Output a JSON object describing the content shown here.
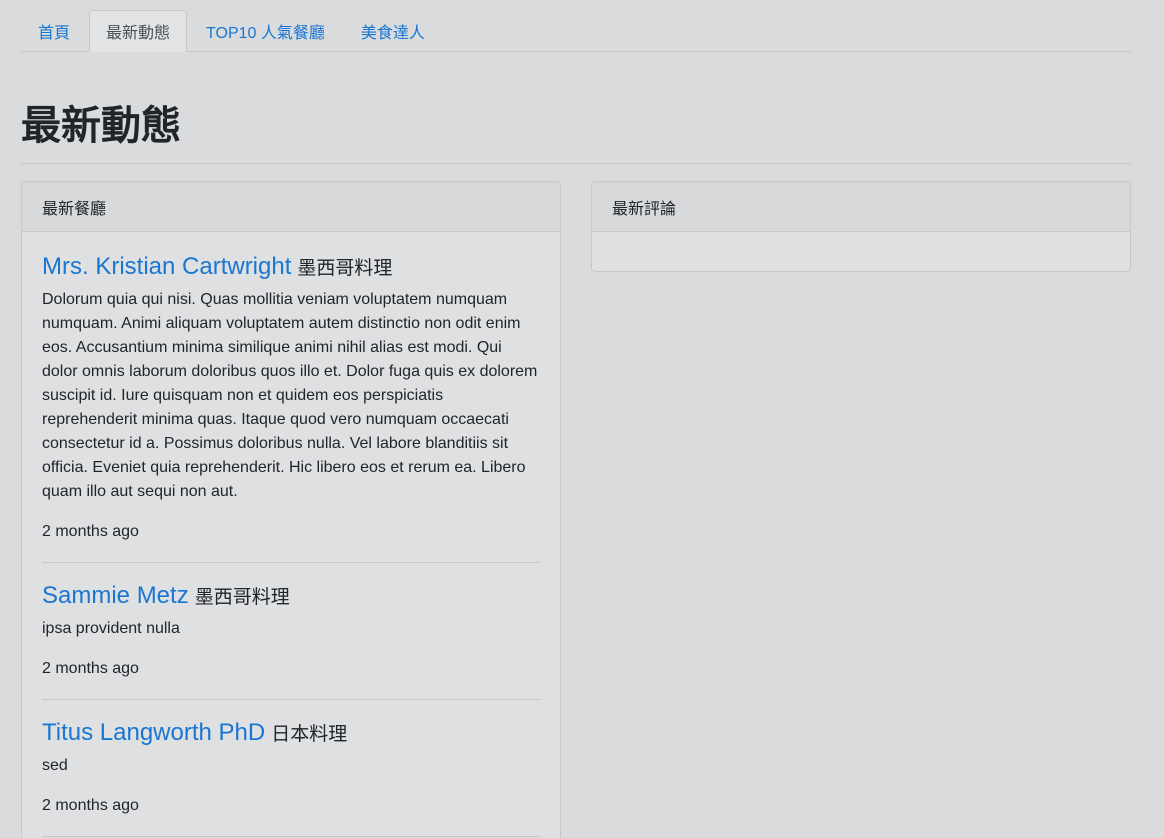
{
  "tabs": [
    {
      "label": "首頁",
      "active": false
    },
    {
      "label": "最新動態",
      "active": true
    },
    {
      "label": "TOP10 人氣餐廳",
      "active": false
    },
    {
      "label": "美食達人",
      "active": false
    }
  ],
  "page": {
    "title": "最新動態"
  },
  "restaurants_card": {
    "header": "最新餐廳",
    "items": [
      {
        "name": "Mrs. Kristian Cartwright",
        "category": "墨西哥料理",
        "description": "Dolorum quia qui nisi. Quas mollitia veniam voluptatem numquam numquam. Animi aliquam voluptatem autem distinctio non odit enim eos. Accusantium minima similique animi nihil alias est modi. Qui dolor omnis laborum doloribus quos illo et. Dolor fuga quis ex dolorem suscipit id. Iure quisquam non et quidem eos perspiciatis reprehenderit minima quas. Itaque quod vero numquam occaecati consectetur id a. Possimus doloribus nulla. Vel labore blanditiis sit officia. Eveniet quia reprehenderit. Hic libero eos et rerum ea. Libero quam illo aut sequi non aut.",
        "time": "2 months ago"
      },
      {
        "name": "Sammie Metz",
        "category": "墨西哥料理",
        "description": "ipsa provident nulla",
        "time": "2 months ago"
      },
      {
        "name": "Titus Langworth PhD",
        "category": "日本料理",
        "description": "sed",
        "time": "2 months ago"
      }
    ]
  },
  "comments_card": {
    "header": "最新評論"
  }
}
